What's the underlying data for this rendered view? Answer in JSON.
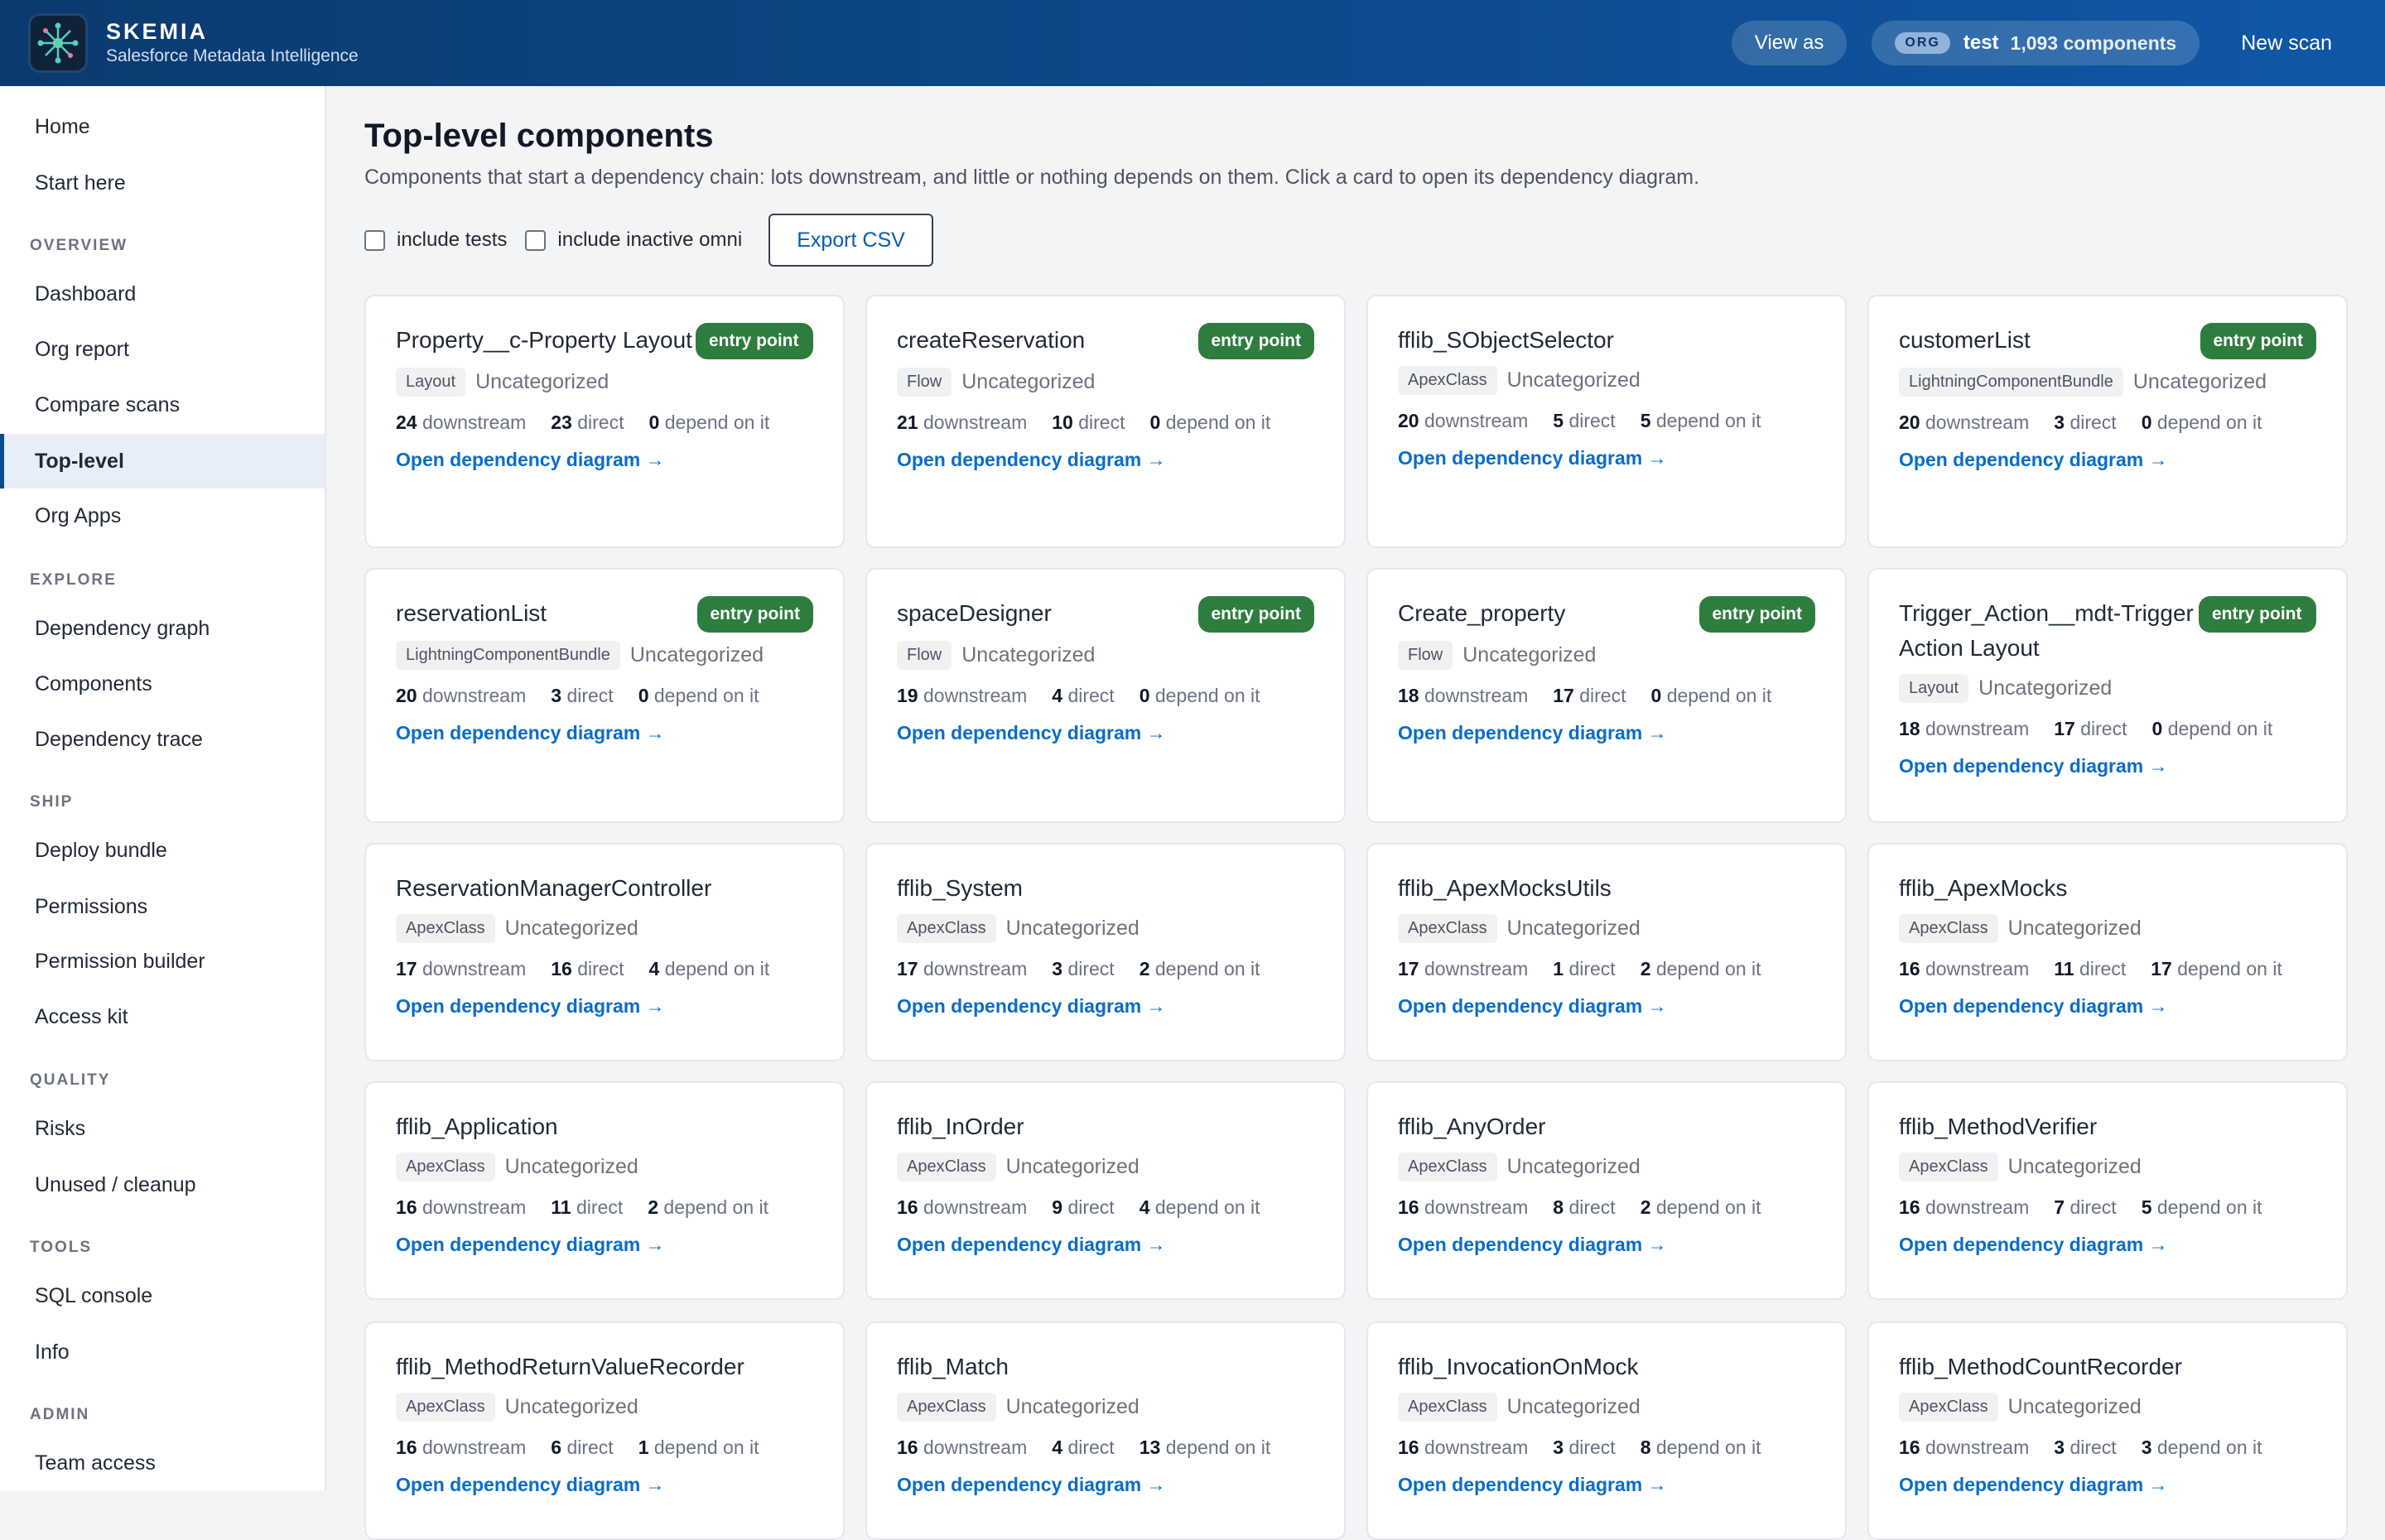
{
  "header": {
    "brand": "SKEMIA",
    "subtitle": "Salesforce Metadata Intelligence",
    "view_as": "View as",
    "org_tag": "ORG",
    "org_name": "test",
    "org_count": "1,093 components",
    "new_scan": "New scan"
  },
  "sidebar": {
    "home": "Home",
    "start_here": "Start here",
    "overview": "OVERVIEW",
    "dashboard": "Dashboard",
    "org_report": "Org report",
    "compare_scans": "Compare scans",
    "top_level": "Top-level",
    "org_apps": "Org Apps",
    "explore": "EXPLORE",
    "dependency_graph": "Dependency graph",
    "components": "Components",
    "dependency_trace": "Dependency trace",
    "ship": "SHIP",
    "deploy_bundle": "Deploy bundle",
    "permissions": "Permissions",
    "permission_builder": "Permission builder",
    "access_kit": "Access kit",
    "quality": "QUALITY",
    "risks": "Risks",
    "unused": "Unused / cleanup",
    "tools": "TOOLS",
    "sql_console": "SQL console",
    "info": "Info",
    "admin": "ADMIN",
    "team_access": "Team access"
  },
  "main": {
    "title": "Top-level components",
    "subtitle": "Components that start a dependency chain: lots downstream, and little or nothing depends on them. Click a card to open its dependency diagram.",
    "include_tests": "include tests",
    "include_inactive": "include inactive omni",
    "export": "Export CSV"
  },
  "labels": {
    "downstream": "downstream",
    "direct": "direct",
    "depend": "depend on it",
    "open": "Open dependency diagram →",
    "entry": "entry point"
  },
  "cards": [
    {
      "title": "Property__c-Property Layout",
      "type": "Layout",
      "category": "Uncategorized",
      "downstream": 24,
      "direct": 23,
      "depend": 0,
      "entry": true
    },
    {
      "title": "createReservation",
      "type": "Flow",
      "category": "Uncategorized",
      "downstream": 21,
      "direct": 10,
      "depend": 0,
      "entry": true
    },
    {
      "title": "fflib_SObjectSelector",
      "type": "ApexClass",
      "category": "Uncategorized",
      "downstream": 20,
      "direct": 5,
      "depend": 5,
      "entry": false
    },
    {
      "title": "customerList",
      "type": "LightningComponentBundle",
      "category": "Uncategorized",
      "downstream": 20,
      "direct": 3,
      "depend": 0,
      "entry": true
    },
    {
      "title": "reservationList",
      "type": "LightningComponentBundle",
      "category": "Uncategorized",
      "downstream": 20,
      "direct": 3,
      "depend": 0,
      "entry": true
    },
    {
      "title": "spaceDesigner",
      "type": "Flow",
      "category": "Uncategorized",
      "downstream": 19,
      "direct": 4,
      "depend": 0,
      "entry": true
    },
    {
      "title": "Create_property",
      "type": "Flow",
      "category": "Uncategorized",
      "downstream": 18,
      "direct": 17,
      "depend": 0,
      "entry": true
    },
    {
      "title": "Trigger_Action__mdt-Trigger Action Layout",
      "type": "Layout",
      "category": "Uncategorized",
      "downstream": 18,
      "direct": 17,
      "depend": 0,
      "entry": true
    },
    {
      "title": "ReservationManagerController",
      "type": "ApexClass",
      "category": "Uncategorized",
      "downstream": 17,
      "direct": 16,
      "depend": 4,
      "entry": false
    },
    {
      "title": "fflib_System",
      "type": "ApexClass",
      "category": "Uncategorized",
      "downstream": 17,
      "direct": 3,
      "depend": 2,
      "entry": false
    },
    {
      "title": "fflib_ApexMocksUtils",
      "type": "ApexClass",
      "category": "Uncategorized",
      "downstream": 17,
      "direct": 1,
      "depend": 2,
      "entry": false
    },
    {
      "title": "fflib_ApexMocks",
      "type": "ApexClass",
      "category": "Uncategorized",
      "downstream": 16,
      "direct": 11,
      "depend": 17,
      "entry": false
    },
    {
      "title": "fflib_Application",
      "type": "ApexClass",
      "category": "Uncategorized",
      "downstream": 16,
      "direct": 11,
      "depend": 2,
      "entry": false
    },
    {
      "title": "fflib_InOrder",
      "type": "ApexClass",
      "category": "Uncategorized",
      "downstream": 16,
      "direct": 9,
      "depend": 4,
      "entry": false
    },
    {
      "title": "fflib_AnyOrder",
      "type": "ApexClass",
      "category": "Uncategorized",
      "downstream": 16,
      "direct": 8,
      "depend": 2,
      "entry": false
    },
    {
      "title": "fflib_MethodVerifier",
      "type": "ApexClass",
      "category": "Uncategorized",
      "downstream": 16,
      "direct": 7,
      "depend": 5,
      "entry": false
    },
    {
      "title": "fflib_MethodReturnValueRecorder",
      "type": "ApexClass",
      "category": "Uncategorized",
      "downstream": 16,
      "direct": 6,
      "depend": 1,
      "entry": false
    },
    {
      "title": "fflib_Match",
      "type": "ApexClass",
      "category": "Uncategorized",
      "downstream": 16,
      "direct": 4,
      "depend": 13,
      "entry": false
    },
    {
      "title": "fflib_InvocationOnMock",
      "type": "ApexClass",
      "category": "Uncategorized",
      "downstream": 16,
      "direct": 3,
      "depend": 8,
      "entry": false
    },
    {
      "title": "fflib_MethodCountRecorder",
      "type": "ApexClass",
      "category": "Uncategorized",
      "downstream": 16,
      "direct": 3,
      "depend": 3,
      "entry": false
    }
  ]
}
